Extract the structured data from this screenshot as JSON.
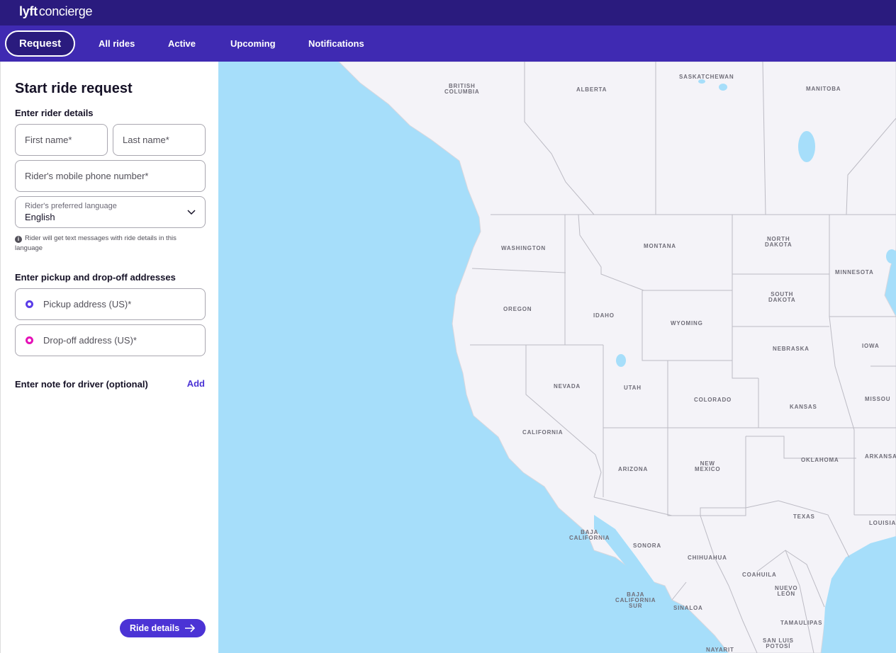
{
  "brand": {
    "logo": "lyft",
    "product": "concierge"
  },
  "nav": {
    "tabs": [
      {
        "label": "Request",
        "active": true
      },
      {
        "label": "All rides"
      },
      {
        "label": "Active"
      },
      {
        "label": "Upcoming"
      },
      {
        "label": "Notifications"
      }
    ]
  },
  "form": {
    "title": "Start ride request",
    "rider_section": "Enter rider details",
    "first_name_placeholder": "First name*",
    "last_name_placeholder": "Last name*",
    "phone_placeholder": "Rider's mobile phone number*",
    "language_label": "Rider's preferred language",
    "language_value": "English",
    "language_hint": "Rider will get text messages with ride details in this language",
    "address_section": "Enter pickup and drop-off addresses",
    "pickup_placeholder": "Pickup address (US)*",
    "dropoff_placeholder": "Drop-off address (US)*",
    "note_label": "Enter note for driver (optional)",
    "note_add": "Add",
    "ride_details_button": "Ride details"
  },
  "map": {
    "labels": {
      "british_columbia": "BRITISH\nCOLUMBIA",
      "alberta": "ALBERTA",
      "saskatchewan": "SASKATCHEWAN",
      "manitoba": "MANITOBA",
      "washington": "WASHINGTON",
      "montana": "MONTANA",
      "north_dakota": "NORTH\nDAKOTA",
      "minnesota": "MINNESOTA",
      "oregon": "OREGON",
      "idaho": "IDAHO",
      "wyoming": "WYOMING",
      "south_dakota": "SOUTH\nDAKOTA",
      "nebraska": "NEBRASKA",
      "iowa": "IOWA",
      "nevada": "NEVADA",
      "utah": "UTAH",
      "colorado": "COLORADO",
      "kansas": "KANSAS",
      "missouri": "MISSOU",
      "california": "CALIFORNIA",
      "arizona": "ARIZONA",
      "new_mexico": "NEW\nMEXICO",
      "oklahoma": "OKLAHOMA",
      "arkansas": "ARKANSA",
      "texas": "TEXAS",
      "louisiana": "LOUISIA",
      "baja_california": "BAJA\nCALIFORNIA",
      "sonora": "SONORA",
      "chihuahua": "CHIHUAHUA",
      "coahuila": "COAHUILA",
      "nuevo_leon": "NUEVO\nLEÓN",
      "baja_california_sur": "BAJA\nCALIFORNIA\nSUR",
      "sinaloa": "SINALOA",
      "tamaulipas": "TAMAULIPAS",
      "san_luis_potosi": "SAN LUIS\nPOTOSÍ",
      "nayarit": "NAYARIT"
    }
  },
  "colors": {
    "topbar": "#2a1b7e",
    "navbar": "#3f2ab2",
    "accent": "#4b33d5",
    "pickup_dot": "#5b3de8",
    "dropoff_dot": "#e511b7",
    "water": "#a6defa",
    "land": "#f4f3f8"
  }
}
